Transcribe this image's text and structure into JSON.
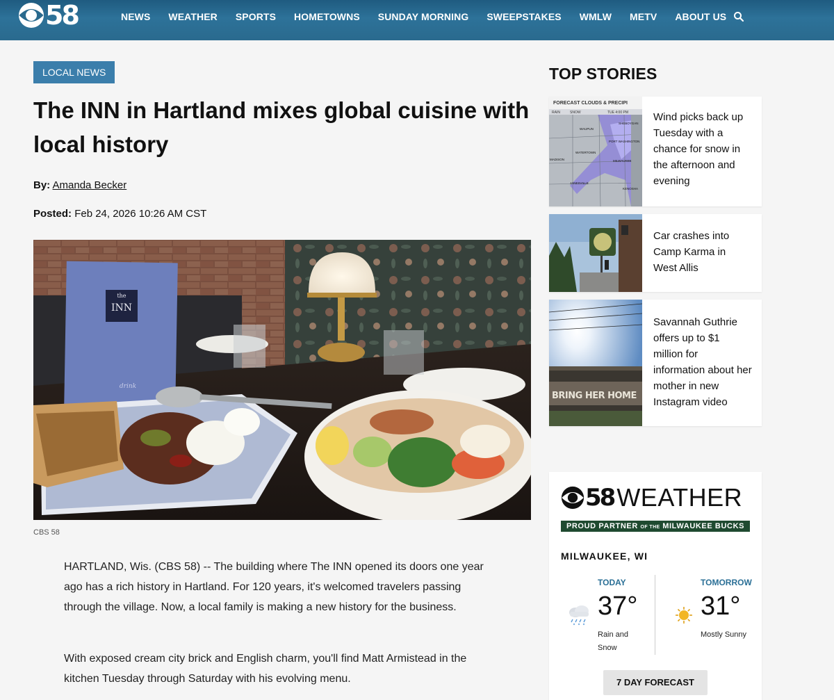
{
  "header": {
    "logo_text": "58",
    "nav": [
      "NEWS",
      "WEATHER",
      "SPORTS",
      "HOMETOWNS",
      "SUNDAY MORNING",
      "SWEEPSTAKES",
      "WMLW",
      "METV",
      "ABOUT US"
    ],
    "search_icon": "search-icon"
  },
  "article": {
    "category": "LOCAL NEWS",
    "headline": "The INN in Hartland mixes global cuisine with local history",
    "by_label": "By:",
    "author": "Amanda Becker",
    "posted_label": "Posted:",
    "posted_date": "Feb 24, 2026 10:26 AM CST",
    "photo_credit": "CBS 58",
    "photo_menu_small": "the",
    "photo_menu_name": "INN",
    "photo_menu_bottom": "drink",
    "paragraphs": [
      "HARTLAND, Wis. (CBS 58) -- The building where The INN opened its doors one year ago has a rich history in Hartland. For 120 years, it's welcomed travelers passing through the village. Now, a local family is making a new history for the business.",
      "With exposed cream city brick and English charm, you'll find Matt Armistead in the kitchen Tuesday through Saturday with his evolving menu."
    ]
  },
  "sidebar": {
    "title": "TOP STORIES",
    "stories": [
      {
        "title": "Wind picks back up Tuesday with a chance for snow in the afternoon and evening",
        "map_title": "FORECAST CLOUDS & PRECIPI",
        "map_legend": [
          "RAIN",
          "SNOW",
          "TUE 4:00 PM"
        ],
        "map_places": [
          "SHEBOYGAN",
          "WAUPUN",
          "PORT WASHINGTON",
          "WATERTOWN",
          "MILWAUKEE",
          "MADISON",
          "JANESVILLE",
          "KENOSHA"
        ]
      },
      {
        "title": "Car crashes into Camp Karma in West Allis"
      },
      {
        "title": "Savannah Guthrie offers up to $1 million for information about her mother in new Instagram video",
        "sign_text": "BRING HER HOME"
      }
    ]
  },
  "weather": {
    "logo_number": "58",
    "logo_word": "WEATHER",
    "partner_left": "PROUD PARTNER",
    "partner_mid": "OF THE",
    "partner_right": "MILWAUKEE BUCKS",
    "city": "MILWAUKEE, WI",
    "today": {
      "label": "TODAY",
      "temp": "37°",
      "condition": "Rain and Snow",
      "icon": "rain-snow-icon"
    },
    "tomorrow": {
      "label": "TOMORROW",
      "temp": "31°",
      "condition": "Mostly Sunny",
      "icon": "sun-icon"
    },
    "button": "7 DAY FORECAST"
  },
  "colors": {
    "header_blue": "#2d7299",
    "badge_blue": "#3b7eab",
    "day_label_blue": "#2a6f96",
    "bucks_green": "#1f4a30"
  }
}
